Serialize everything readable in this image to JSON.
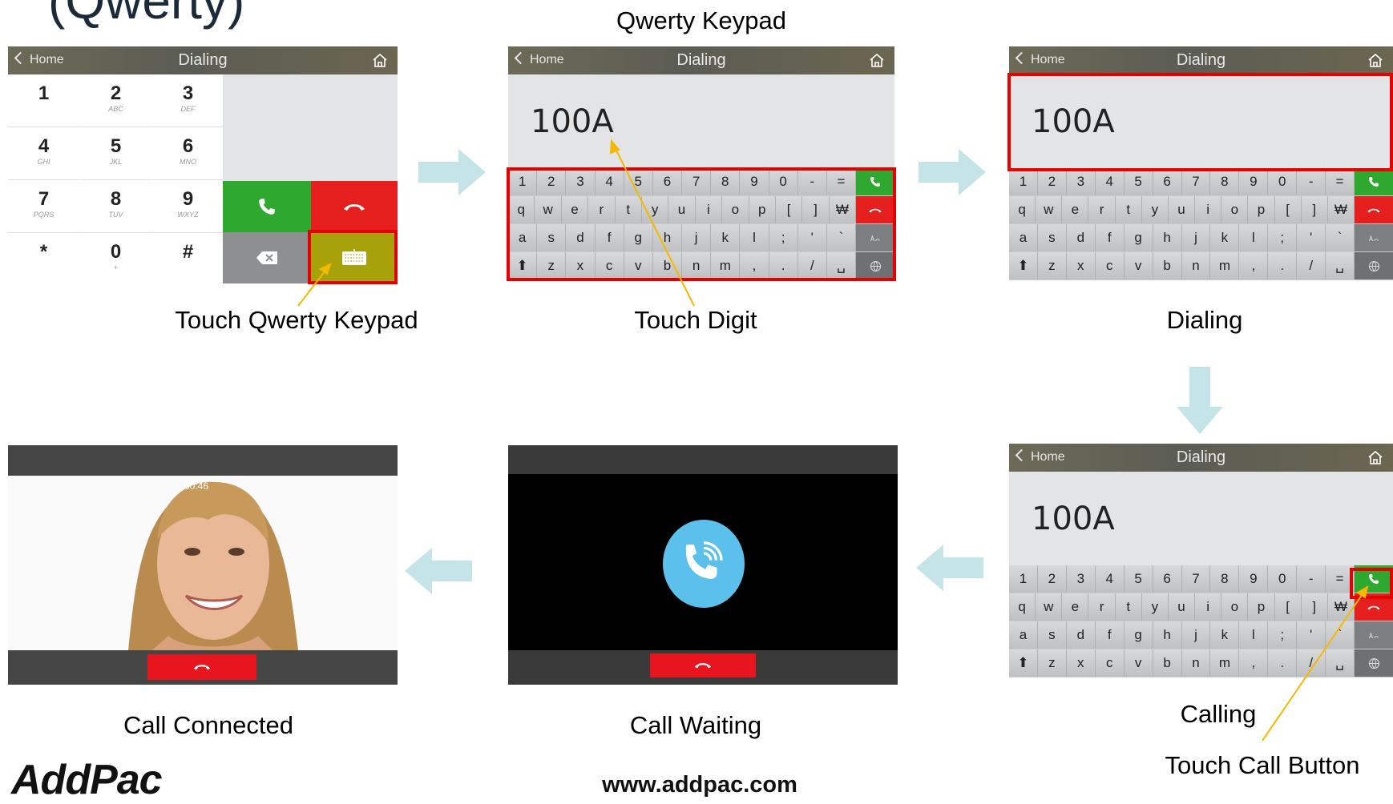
{
  "top_left_title_fragment": "(Qwerty)",
  "screens": {
    "header": {
      "back_label": "Home",
      "title": "Dialing"
    },
    "dialed_number": "100A",
    "keypad": {
      "keys": [
        {
          "digit": "1",
          "letters": ""
        },
        {
          "digit": "2",
          "letters": "ABC"
        },
        {
          "digit": "3",
          "letters": "DEF"
        },
        {
          "digit": "4",
          "letters": "GHI"
        },
        {
          "digit": "5",
          "letters": "JKL"
        },
        {
          "digit": "6",
          "letters": "MNO"
        },
        {
          "digit": "7",
          "letters": "PQRS"
        },
        {
          "digit": "8",
          "letters": "TUV"
        },
        {
          "digit": "9",
          "letters": "WXYZ"
        },
        {
          "digit": "*",
          "letters": ""
        },
        {
          "digit": "0",
          "letters": "+"
        },
        {
          "digit": "#",
          "letters": ""
        }
      ]
    },
    "qwerty_rows": [
      [
        "1",
        "2",
        "3",
        "4",
        "5",
        "6",
        "7",
        "8",
        "9",
        "0",
        "-",
        "="
      ],
      [
        "q",
        "w",
        "e",
        "r",
        "t",
        "y",
        "u",
        "i",
        "o",
        "p",
        "[",
        "]",
        "₩"
      ],
      [
        "a",
        "s",
        "d",
        "f",
        "g",
        "h",
        "j",
        "k",
        "l",
        ";",
        "'",
        "`"
      ],
      [
        "⬆",
        "z",
        "x",
        "c",
        "v",
        "b",
        "n",
        "m",
        ",",
        ".",
        "/",
        "␣"
      ]
    ],
    "call_timer": "00:46"
  },
  "captions": {
    "qwerty_keypad": "Qwerty Keypad",
    "touch_qwerty_keypad": "Touch Qwerty Keypad",
    "touch_digit": "Touch Digit",
    "dialing": "Dialing",
    "calling": "Calling",
    "touch_call_button": "Touch Call Button",
    "call_waiting": "Call Waiting",
    "call_connected": "Call Connected"
  },
  "footer": {
    "logo": "AddPac",
    "url": "www.addpac.com"
  },
  "colors": {
    "accent_red": "#e60000",
    "call_green": "#2fa82f",
    "hangup_red": "#e51e1e",
    "arrow": "#c5e4e8",
    "pointer": "#f5b800",
    "waiting_blue": "#5bc0eb"
  }
}
